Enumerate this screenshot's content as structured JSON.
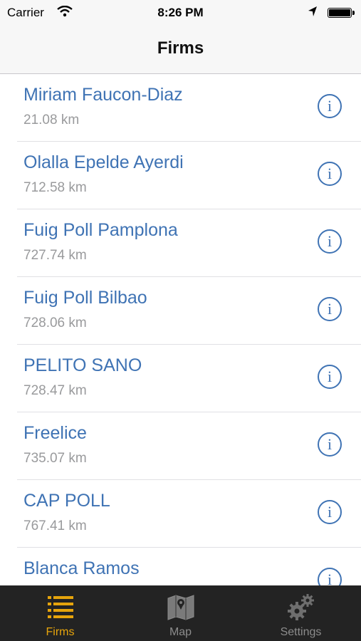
{
  "status": {
    "carrier": "Carrier",
    "time": "8:26 PM"
  },
  "nav": {
    "title": "Firms"
  },
  "firms": [
    {
      "name": "Miriam Faucon-Diaz",
      "distance": "21.08 km"
    },
    {
      "name": "Olalla Epelde Ayerdi",
      "distance": "712.58 km"
    },
    {
      "name": "Fuig Poll Pamplona",
      "distance": "727.74 km"
    },
    {
      "name": "Fuig Poll Bilbao",
      "distance": "728.06 km"
    },
    {
      "name": "PELITO SANO",
      "distance": "728.47 km"
    },
    {
      "name": "Freelice",
      "distance": "735.07 km"
    },
    {
      "name": "CAP POLL",
      "distance": "767.41 km"
    },
    {
      "name": "Blanca Ramos",
      "distance": ""
    }
  ],
  "tabs": [
    {
      "label": "Firms",
      "icon": "list-icon",
      "active": true
    },
    {
      "label": "Map",
      "icon": "map-icon",
      "active": false
    },
    {
      "label": "Settings",
      "icon": "gears-icon",
      "active": false
    }
  ],
  "colors": {
    "accent": "#3f73b4",
    "tab_active": "#e6a40c",
    "tab_bg": "#232323"
  }
}
